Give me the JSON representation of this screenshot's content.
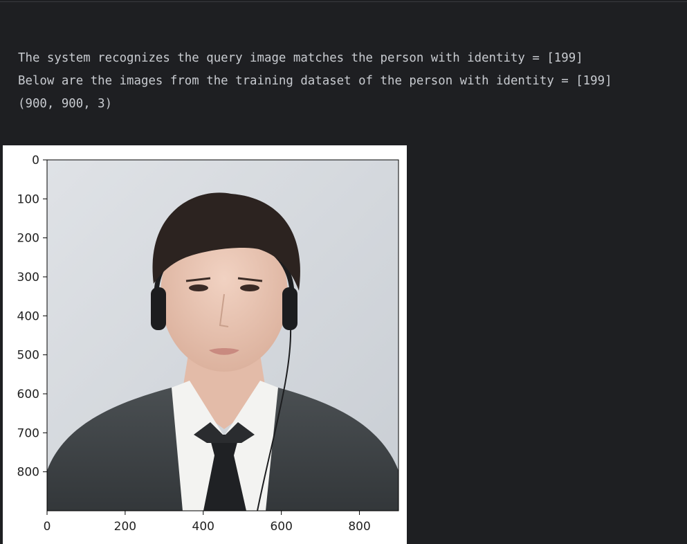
{
  "output": {
    "lines": [
      "The system recognizes the query image matches the person with identity = [199]",
      "Below are the images from the training dataset of the person with identity = [199]",
      "(900, 900, 3)"
    ]
  },
  "chart_data": {
    "type": "image",
    "xlim": [
      0,
      900
    ],
    "ylim": [
      900,
      0
    ],
    "xticks": [
      "0",
      "200",
      "400",
      "600",
      "800"
    ],
    "yticks": [
      "0",
      "100",
      "200",
      "300",
      "400",
      "500",
      "600",
      "700",
      "800"
    ],
    "grid": false
  }
}
